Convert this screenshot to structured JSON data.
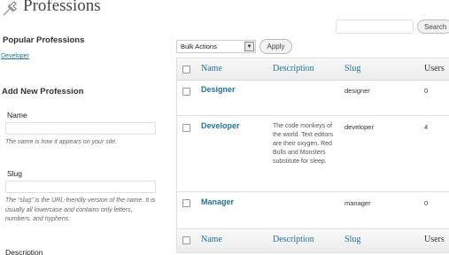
{
  "header": {
    "title": "Professions",
    "icon": "pushpin-icon"
  },
  "popular": {
    "title": "Popular Professions",
    "tags": [
      "Developer"
    ]
  },
  "add_new": {
    "title": "Add New Profession",
    "name_label": "Name",
    "name_help": "The name is how it appears on your site.",
    "slug_label": "Slug",
    "slug_help": "The “slug” is the URL-friendly version of the name. It is usually all lowercase and contains only letters, numbers, and hyphens.",
    "description_label": "Description"
  },
  "search": {
    "button_label": "Search"
  },
  "bulk": {
    "selected": "Bulk Actions",
    "apply_label": "Apply"
  },
  "table": {
    "columns": {
      "name": "Name",
      "description": "Description",
      "slug": "Slug",
      "users": "Users"
    },
    "rows": [
      {
        "name": "Designer",
        "description": "",
        "slug": "designer",
        "users": "0"
      },
      {
        "name": "Developer",
        "description": "The code monkeys of the world. Text editors are their oxygen. Red Bulls and Monsters substitute for sleep.",
        "slug": "developer",
        "users": "4"
      },
      {
        "name": "Manager",
        "description": "",
        "slug": "manager",
        "users": "0"
      }
    ]
  },
  "colors": {
    "link": "#21759b",
    "border": "#dfdfdf",
    "header_bg": "#f1f1f1"
  }
}
